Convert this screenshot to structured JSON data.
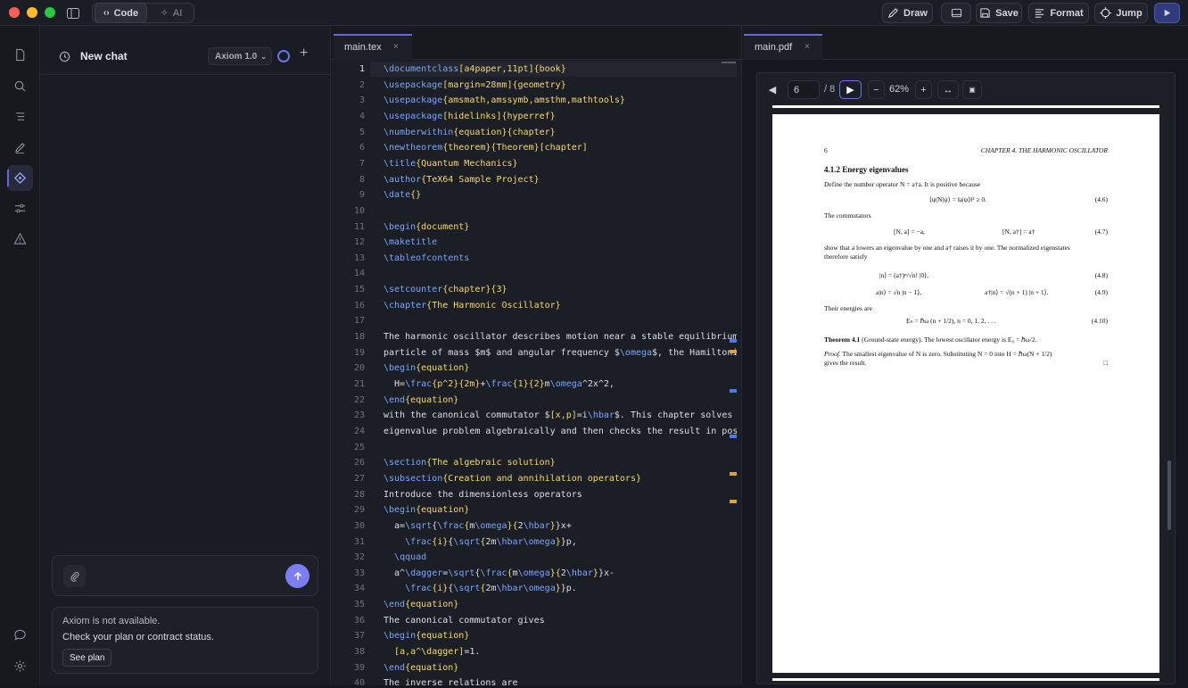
{
  "toolbar": {
    "code_label": "Code",
    "ai_label": "AI",
    "draw_label": "Draw",
    "save_label": "Save",
    "format_label": "Format",
    "jump_label": "Jump"
  },
  "chat": {
    "title": "New chat",
    "model": "Axiom 1.0",
    "unavailable_title": "Axiom is not available.",
    "unavailable_body": "Check your plan or contract status.",
    "see_plan": "See plan"
  },
  "editor": {
    "tab": "main.tex",
    "close": "×"
  },
  "code_lines": [
    "\\documentclass[a4paper,11pt]{book}",
    "\\usepackage[margin=28mm]{geometry}",
    "\\usepackage{amsmath,amssymb,amsthm,mathtools}",
    "\\usepackage[hidelinks]{hyperref}",
    "\\numberwithin{equation}{chapter}",
    "\\newtheorem{theorem}{Theorem}[chapter]",
    "\\title{Quantum Mechanics}",
    "\\author{TeX64 Sample Project}",
    "\\date{}",
    "",
    "\\begin{document}",
    "\\maketitle",
    "\\tableofcontents",
    "",
    "\\setcounter{chapter}{3}",
    "\\chapter{The Harmonic Oscillator}",
    "",
    "The harmonic oscillator describes motion near a stable equilibrium. For",
    "particle of mass $m$ and angular frequency $\\omega$, the Hamiltonian is",
    "\\begin{equation}",
    "  H=\\frac{p^2}{2m}+\\frac{1}{2}m\\omega^2x^2,",
    "\\end{equation}",
    "with the canonical commutator $[x,p]=i\\hbar$. This chapter solves the",
    "eigenvalue problem algebraically and then checks the result in position",
    "",
    "\\section{The algebraic solution}",
    "\\subsection{Creation and annihilation operators}",
    "Introduce the dimensionless operators",
    "\\begin{equation}",
    "  a=\\sqrt{\\frac{m\\omega}{2\\hbar}}x+",
    "    \\frac{i}{\\sqrt{2m\\hbar\\omega}}p,",
    "  \\qquad",
    "  a^\\dagger=\\sqrt{\\frac{m\\omega}{2\\hbar}}x-",
    "    \\frac{i}{\\sqrt{2m\\hbar\\omega}}p.",
    "\\end{equation}",
    "The canonical commutator gives",
    "\\begin{equation}",
    "  [a,a^\\dagger]=1.",
    "\\end{equation}",
    "The inverse relations are"
  ],
  "line_numbers": [
    "1",
    "2",
    "3",
    "4",
    "5",
    "6",
    "7",
    "8",
    "9",
    "10",
    "11",
    "12",
    "13",
    "14",
    "15",
    "16",
    "17",
    "18",
    "19",
    "20",
    "21",
    "22",
    "23",
    "24",
    "25",
    "26",
    "27",
    "28",
    "29",
    "30",
    "31",
    "32",
    "33",
    "34",
    "35",
    "36",
    "37",
    "38",
    "39",
    "40"
  ],
  "pdf": {
    "tab": "main.pdf",
    "close": "×",
    "page_value": "6",
    "page_total": "/ 8",
    "zoom": "62%",
    "header_page": "6",
    "header_chapter": "CHAPTER 4.  THE HARMONIC OSCILLATOR",
    "subsection": "4.1.2   Energy eigenvalues",
    "p1": "Define the number operator N = a†a. It is positive because",
    "eq46": "⟨ψ|N|ψ⟩ = ‖a|ψ⟩‖² ≥ 0.",
    "n46": "(4.6)",
    "p2": "The commutators",
    "eq47a": "[N, a] = −a,",
    "eq47b": "[N, a†] = a†",
    "n47": "(4.7)",
    "p3": "show that a lowers an eigenvalue by one and a† raises it by one.  The normalized eigenstates",
    "p3b": "therefore satisfy",
    "eq48": "|n⟩ = (a†)ⁿ/√n! |0⟩,",
    "n48": "(4.8)",
    "eq49a": "a|n⟩ = √n |n − 1⟩,",
    "eq49b": "a†|n⟩ = √(n + 1) |n + 1⟩.",
    "n49": "(4.9)",
    "p4": "Their energies are",
    "eq410": "Eₙ = ℏω (n + 1/2),      n = 0, 1, 2, . . .",
    "n410": "(4.10)",
    "thm": "Theorem 4.1",
    "thm_rest": "(Ground-state energy).  The lowest oscillator energy is E₀ = ℏω/2.",
    "proof": "Proof.",
    "proof_rest": "The smallest eigenvalue of N is zero.  Substituting N = 0 into H = ℏω(N + 1/2)",
    "proof2": "gives the result.",
    "qed": "□"
  },
  "colors": {
    "accent": "#5f6ad8",
    "keyword": "#78a7ff",
    "argument": "#f6d86e",
    "send": "#7b7ef0"
  }
}
